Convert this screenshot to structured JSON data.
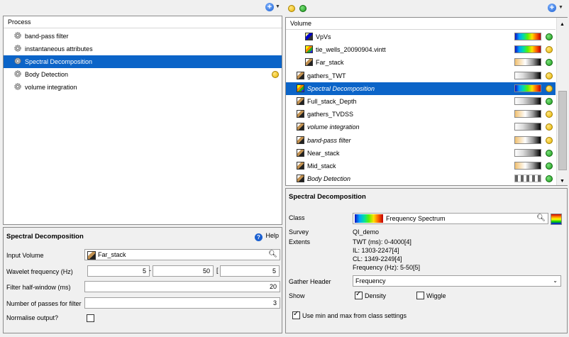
{
  "left": {
    "column_header": "Process",
    "processes": [
      {
        "label": "band-pass filter",
        "selected": false,
        "status": null
      },
      {
        "label": "instantaneous attributes",
        "selected": false,
        "status": null
      },
      {
        "label": "Spectral Decomposition",
        "selected": true,
        "status": null
      },
      {
        "label": "Body Detection",
        "selected": false,
        "status": "yellow"
      },
      {
        "label": "volume integration",
        "selected": false,
        "status": null
      }
    ],
    "params": {
      "title": "Spectral Decomposition",
      "help": "Help",
      "input_volume_label": "Input Volume",
      "input_volume_value": "Far_stack",
      "wavelet_label": "Wavelet frequency (Hz)",
      "wavelet_from": "5",
      "wavelet_sep": "-",
      "wavelet_to": "50",
      "wavelet_bracket": "[",
      "wavelet_step": "5",
      "halfwindow_label": "Filter half-window (ms)",
      "halfwindow_value": "20",
      "passes_label": "Number of passes for filter",
      "passes_value": "3",
      "normalise_label": "Normalise output?",
      "normalise_checked": false
    }
  },
  "right": {
    "column_header": "Volume",
    "volumes": [
      {
        "label": "VpVs",
        "indent": 2,
        "icon": "cube",
        "colorbar": "rainbow",
        "status": "green",
        "italic": false,
        "selected": false
      },
      {
        "label": "tie_wells_20090904.vintt",
        "indent": 2,
        "icon": "bright",
        "colorbar": "rainbow",
        "status": "yellow",
        "italic": false,
        "selected": false
      },
      {
        "label": "Far_stack",
        "indent": 2,
        "icon": "seismic",
        "colorbar": "warm",
        "status": "green",
        "italic": false,
        "selected": false
      },
      {
        "label": "gathers_TWT",
        "indent": 1,
        "icon": "seismic",
        "colorbar": "grey",
        "status": "yellow",
        "italic": false,
        "selected": false
      },
      {
        "label": "Spectral Decomposition",
        "indent": 1,
        "icon": "bright",
        "colorbar": "rainbow",
        "status": "yellow",
        "italic": true,
        "selected": true
      },
      {
        "label": "Full_stack_Depth",
        "indent": 1,
        "icon": "seismic",
        "colorbar": "grey",
        "status": "green",
        "italic": false,
        "selected": false
      },
      {
        "label": "gathers_TVDSS",
        "indent": 1,
        "icon": "seismic",
        "colorbar": "warm",
        "status": "yellow",
        "italic": false,
        "selected": false
      },
      {
        "label": "volume integration",
        "indent": 1,
        "icon": "seismic",
        "colorbar": "grey",
        "status": "yellow",
        "italic": true,
        "selected": false
      },
      {
        "label": "band-pass filter",
        "indent": 1,
        "icon": "seismic",
        "colorbar": "warm",
        "status": "yellow",
        "italic": true,
        "selected": false
      },
      {
        "label": "Near_stack",
        "indent": 1,
        "icon": "seismic",
        "colorbar": "grey",
        "status": "green",
        "italic": false,
        "selected": false
      },
      {
        "label": "Mid_stack",
        "indent": 1,
        "icon": "seismic",
        "colorbar": "warm",
        "status": "green",
        "italic": false,
        "selected": false
      },
      {
        "label": "Body Detection",
        "indent": 1,
        "icon": "seismic",
        "colorbar": "checker",
        "status": "green",
        "italic": true,
        "selected": false
      }
    ],
    "details": {
      "title": "Spectral Decomposition",
      "class_label": "Class",
      "class_value": "Frequency Spectrum",
      "survey_label": "Survey",
      "survey_value": "QI_demo",
      "extents_label": "Extents",
      "extents_lines": [
        "TWT (ms): 0-4000[4]",
        "IL: 1303-2247[4]",
        "CL: 1349-2249[4]",
        "Frequency (Hz): 5-50[5]"
      ],
      "gather_label": "Gather Header",
      "gather_value": "Frequency",
      "show_label": "Show",
      "density_label": "Density",
      "density_checked": true,
      "wiggle_label": "Wiggle",
      "wiggle_checked": false,
      "minmax_label": "Use min and max from class settings",
      "minmax_checked": true
    }
  },
  "colors": {
    "selection": "#0b64c8",
    "status_green": "#1c9a1c",
    "status_yellow": "#e8b400"
  }
}
